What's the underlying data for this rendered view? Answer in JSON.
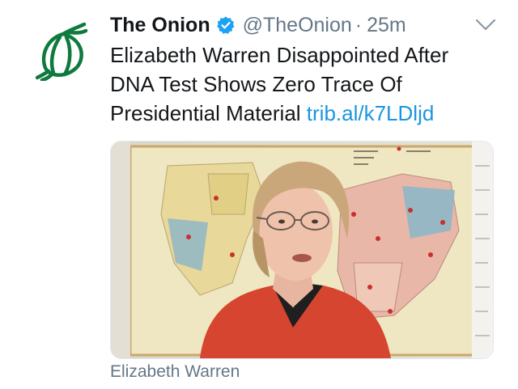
{
  "tweet": {
    "display_name": "The Onion",
    "handle": "@TheOnion",
    "separator": "·",
    "time": "25m",
    "text": "Elizabeth Warren Disappointed After DNA Test Shows Zero Trace Of Presidential Material",
    "link": "trib.al/k7LDljd",
    "media_caption": "Elizabeth Warren",
    "icons": [
      "onion-logo-icon",
      "verified-badge-icon",
      "chevron-down-icon"
    ],
    "colors": {
      "link": "#1b95e0",
      "secondary": "#657786",
      "verified": "#1da1f2",
      "brand": "#0f7a3d"
    }
  }
}
